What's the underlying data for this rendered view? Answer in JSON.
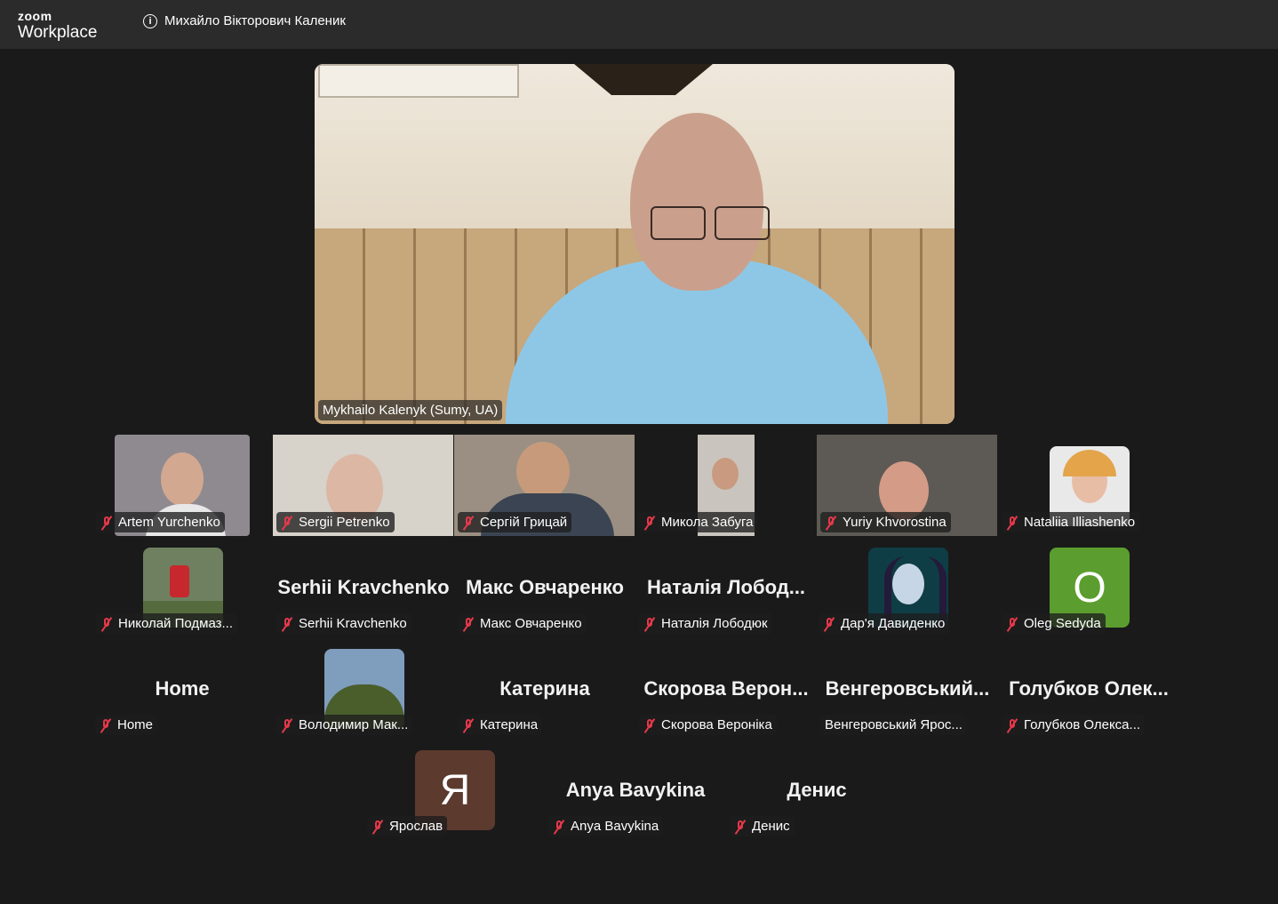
{
  "app": {
    "brand_small": "zoom",
    "brand_large": "Workplace"
  },
  "meeting": {
    "host_title": "Михайло Вікторович Каленик"
  },
  "speaker": {
    "name": "Mykhailo Kalenyk (Sumy, UA)"
  },
  "participants": [
    {
      "name": "Artem Yurchenko"
    },
    {
      "name": "Sergii Petrenko"
    },
    {
      "name": "Сергій Грицай"
    },
    {
      "name": "Микола Забуга"
    },
    {
      "name": "Yuriy Khvorostina"
    },
    {
      "name": "Nataliia Illiashenko"
    },
    {
      "name": "Николай Подмаз..."
    },
    {
      "name": "Serhii Kravchenko",
      "display": "Serhii Kravchenko"
    },
    {
      "name": "Макс Овчаренко",
      "display": "Макс Овчаренко"
    },
    {
      "name": "Наталія Лободюк",
      "display": "Наталія Лобод..."
    },
    {
      "name": "Дар'я Давиденко"
    },
    {
      "name": "Oleg Sedyda",
      "initial": "O"
    },
    {
      "name": "Home",
      "display": "Home"
    },
    {
      "name": "Володимир Мак..."
    },
    {
      "name": "Катерина",
      "display": "Катерина"
    },
    {
      "name": "Скорова Вероніка",
      "display": "Скорова Верон..."
    },
    {
      "name": "Венгеровський Ярос...",
      "display": "Венгеровський..."
    },
    {
      "name": "Голубков Олекса...",
      "display": "Голубков Олек..."
    },
    {
      "name": "Ярослав",
      "initial": "Я"
    },
    {
      "name": "Anya Bavykina",
      "display": "Anya Bavykina"
    },
    {
      "name": "Денис",
      "display": "Денис"
    }
  ],
  "colors": {
    "background": "#1a1a1a",
    "topbar": "#2b2b2b",
    "muted_icon": "#e5394a",
    "avatar_green": "#5b9e2f",
    "avatar_brown": "#5c3a2e"
  },
  "icons": [
    "info-icon",
    "muted-mic-icon"
  ]
}
